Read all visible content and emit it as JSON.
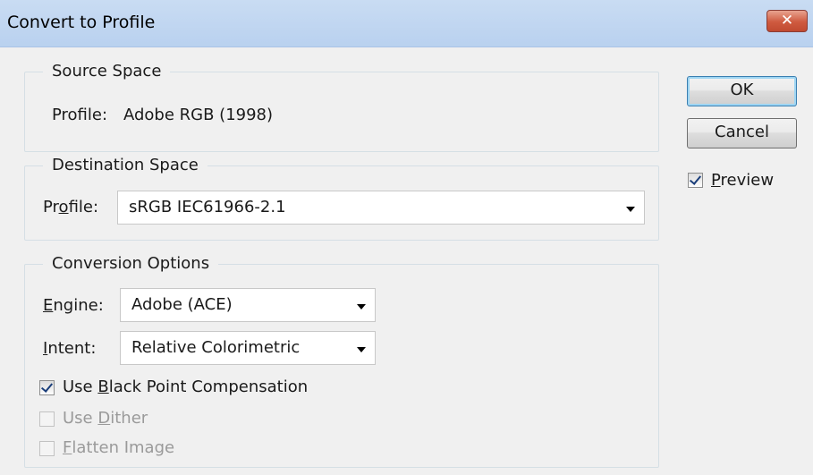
{
  "window": {
    "title": "Convert to Profile",
    "close_glyph": "✕"
  },
  "source_space": {
    "legend": "Source Space",
    "profile_label": "Profile:",
    "profile_value": "Adobe RGB (1998)"
  },
  "destination_space": {
    "legend": "Destination Space",
    "profile_label_pre": "Pr",
    "profile_label_ul": "o",
    "profile_label_post": "file:",
    "profile_value": "sRGB IEC61966-2.1"
  },
  "conversion_options": {
    "legend": "Conversion Options",
    "engine_label_ul": "E",
    "engine_label_post": "ngine:",
    "engine_value": "Adobe (ACE)",
    "intent_label_ul": "I",
    "intent_label_post": "ntent:",
    "intent_value": "Relative Colorimetric",
    "bpc_label_pre": "Use ",
    "bpc_label_ul": "B",
    "bpc_label_post": "lack Point Compensation",
    "bpc_checked": true,
    "dither_label_pre": "Use ",
    "dither_label_ul": "D",
    "dither_label_post": "ither",
    "dither_checked": false,
    "dither_enabled": false,
    "flatten_label_ul": "F",
    "flatten_label_post": "latten Image",
    "flatten_checked": false,
    "flatten_enabled": false
  },
  "buttons": {
    "ok": "OK",
    "cancel": "Cancel"
  },
  "preview": {
    "label_ul": "P",
    "label_post": "review",
    "checked": true
  }
}
